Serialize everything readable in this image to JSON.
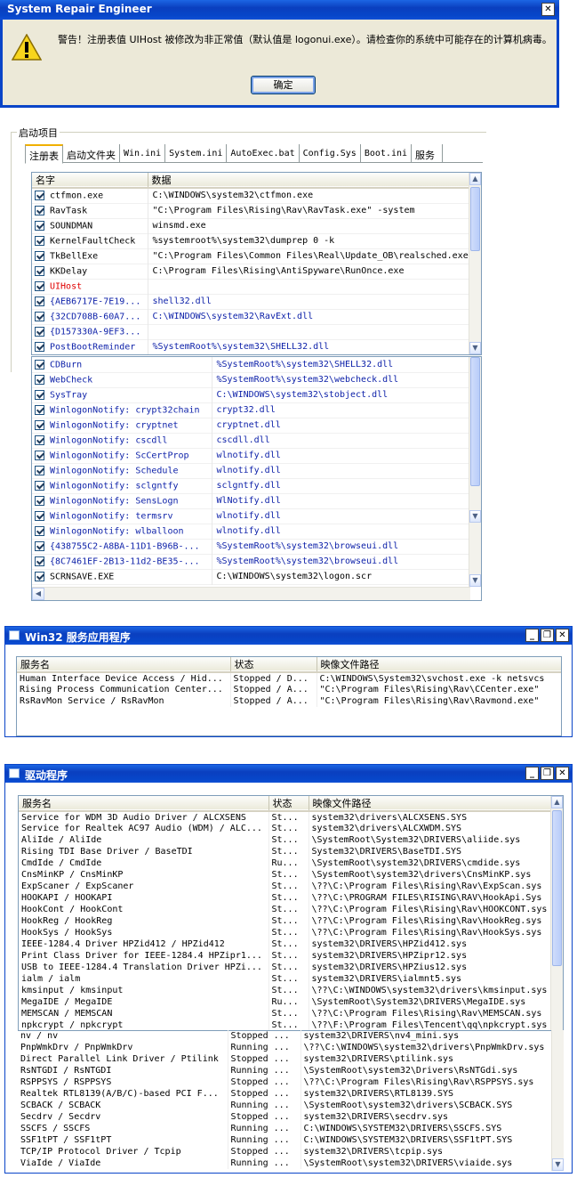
{
  "alert": {
    "title": "System Repair Engineer",
    "message": "警告！注册表值 UIHost 被修改为非正常值（默认值是 logonui.exe）。请检查你的系统中可能存在的计算机病毒。",
    "ok": "确定"
  },
  "startup": {
    "group_title": "启动项目",
    "tabs": [
      "注册表",
      "启动文件夹",
      "Win.ini",
      "System.ini",
      "AutoExec.bat",
      "Config.Sys",
      "Boot.ini",
      "服务"
    ],
    "columns": [
      "名字",
      "数据"
    ],
    "rows1": [
      {
        "name": "ctfmon.exe",
        "data": "C:\\WINDOWS\\system32\\ctfmon.exe",
        "color": "black"
      },
      {
        "name": "RavTask",
        "data": "\"C:\\Program Files\\Rising\\Rav\\RavTask.exe\" -system",
        "color": "black"
      },
      {
        "name": "SOUNDMAN",
        "data": "winsmd.exe",
        "color": "black"
      },
      {
        "name": "KernelFaultCheck",
        "data": "%systemroot%\\system32\\dumprep 0 -k",
        "color": "black"
      },
      {
        "name": "TkBellExe",
        "data": "\"C:\\Program Files\\Common Files\\Real\\Update_OB\\realsched.exe\"",
        "color": "black"
      },
      {
        "name": "KKDelay",
        "data": "C:\\Program Files\\Rising\\AntiSpyware\\RunOnce.exe",
        "color": "black"
      },
      {
        "name": "UIHost",
        "data": "",
        "color": "red"
      },
      {
        "name": "{AEB6717E-7E19...",
        "data": "shell32.dll",
        "color": "blue"
      },
      {
        "name": "{32CD708B-60A7...",
        "data": "C:\\WINDOWS\\system32\\RavExt.dll",
        "color": "blue"
      },
      {
        "name": "{D157330A-9EF3...",
        "data": "",
        "color": "blue"
      },
      {
        "name": "PostBootReminder",
        "data": "%SystemRoot%\\system32\\SHELL32.dll",
        "color": "blue"
      }
    ],
    "rows2": [
      {
        "name": "CDBurn",
        "data": "%SystemRoot%\\system32\\SHELL32.dll",
        "color": "blue"
      },
      {
        "name": "WebCheck",
        "data": "%SystemRoot%\\system32\\webcheck.dll",
        "color": "blue"
      },
      {
        "name": "SysTray",
        "data": "C:\\WINDOWS\\system32\\stobject.dll",
        "color": "blue"
      },
      {
        "name": "WinlogonNotify: crypt32chain",
        "data": "crypt32.dll",
        "color": "blue"
      },
      {
        "name": "WinlogonNotify: cryptnet",
        "data": "cryptnet.dll",
        "color": "blue"
      },
      {
        "name": "WinlogonNotify: cscdll",
        "data": "cscdll.dll",
        "color": "blue"
      },
      {
        "name": "WinlogonNotify: ScCertProp",
        "data": "wlnotify.dll",
        "color": "blue"
      },
      {
        "name": "WinlogonNotify: Schedule",
        "data": "wlnotify.dll",
        "color": "blue"
      },
      {
        "name": "WinlogonNotify: sclgntfy",
        "data": "sclgntfy.dll",
        "color": "blue"
      },
      {
        "name": "WinlogonNotify: SensLogn",
        "data": "WlNotify.dll",
        "color": "blue"
      },
      {
        "name": "WinlogonNotify: termsrv",
        "data": "wlnotify.dll",
        "color": "blue"
      },
      {
        "name": "WinlogonNotify: wlballoon",
        "data": "wlnotify.dll",
        "color": "blue"
      },
      {
        "name": "{438755C2-A8BA-11D1-B96B-...",
        "data": "%SystemRoot%\\system32\\browseui.dll",
        "color": "blue"
      },
      {
        "name": "{8C7461EF-2B13-11d2-BE35-...",
        "data": "%SystemRoot%\\system32\\browseui.dll",
        "color": "blue"
      },
      {
        "name": "SCRNSAVE.EXE",
        "data": "C:\\WINDOWS\\system32\\logon.scr",
        "color": "black"
      }
    ]
  },
  "services": {
    "title": "Win32 服务应用程序",
    "columns": [
      "服务名",
      "状态",
      "映像文件路径"
    ],
    "rows": [
      [
        "Human Interface Device Access / Hid...",
        "Stopped / D...",
        "C:\\WINDOWS\\System32\\svchost.exe -k netsvcs"
      ],
      [
        "Rising Process Communication Center...",
        "Stopped / A...",
        "\"C:\\Program Files\\Rising\\Rav\\CCenter.exe\""
      ],
      [
        "RsRavMon Service / RsRavMon",
        "Stopped / A...",
        "\"C:\\Program Files\\Rising\\Rav\\Ravmond.exe\""
      ]
    ]
  },
  "drivers": {
    "title": "驱动程序",
    "columns": [
      "服务名",
      "状态",
      "映像文件路径"
    ],
    "rows1": [
      [
        "Service for WDM 3D Audio Driver / ALCXSENS",
        "St...",
        "system32\\drivers\\ALCXSENS.SYS"
      ],
      [
        "Service for Realtek AC97 Audio (WDM) / ALC...",
        "St...",
        "system32\\drivers\\ALCXWDM.SYS"
      ],
      [
        "AliIde / AliIde",
        "St...",
        "\\SystemRoot\\System32\\DRIVERS\\aliide.sys"
      ],
      [
        "Rising TDI Base Driver / BaseTDI",
        "St...",
        "System32\\DRIVERS\\BaseTDI.SYS"
      ],
      [
        "CmdIde / CmdIde",
        "Ru...",
        "\\SystemRoot\\system32\\DRIVERS\\cmdide.sys"
      ],
      [
        "CnsMinKP / CnsMinKP",
        "St...",
        "\\SystemRoot\\system32\\drivers\\CnsMinKP.sys"
      ],
      [
        "ExpScaner / ExpScaner",
        "St...",
        "\\??\\C:\\Program Files\\Rising\\Rav\\ExpScan.sys"
      ],
      [
        "HOOKAPI / HOOKAPI",
        "St...",
        "\\??\\C:\\PROGRAM FILES\\RISING\\RAV\\HookApi.Sys"
      ],
      [
        "HookCont / HookCont",
        "St...",
        "\\??\\C:\\Program Files\\Rising\\Rav\\HOOKCONT.sys"
      ],
      [
        "HookReg / HookReg",
        "St...",
        "\\??\\C:\\Program Files\\Rising\\Rav\\HookReg.sys"
      ],
      [
        "HookSys / HookSys",
        "St...",
        "\\??\\C:\\Program Files\\Rising\\Rav\\HookSys.sys"
      ],
      [
        "IEEE-1284.4 Driver HPZid412 / HPZid412",
        "St...",
        "system32\\DRIVERS\\HPZid412.sys"
      ],
      [
        "Print Class Driver for IEEE-1284.4 HPZipr1...",
        "St...",
        "system32\\DRIVERS\\HPZipr12.sys"
      ],
      [
        "USB to IEEE-1284.4 Translation Driver HPZi...",
        "St...",
        "system32\\DRIVERS\\HPZius12.sys"
      ],
      [
        "ialm / ialm",
        "St...",
        "system32\\DRIVERS\\ialmnt5.sys"
      ],
      [
        "kmsinput / kmsinput",
        "St...",
        "\\??\\C:\\WINDOWS\\system32\\drivers\\kmsinput.sys"
      ],
      [
        "MegaIDE / MegaIDE",
        "Ru...",
        "\\SystemRoot\\System32\\DRIVERS\\MegaIDE.sys"
      ],
      [
        "MEMSCAN / MEMSCAN",
        "St...",
        "\\??\\C:\\Program Files\\Rising\\Rav\\MEMSCAN.sys"
      ],
      [
        "npkcrypt / npkcrypt",
        "St...",
        "\\??\\F:\\Program Files\\Tencent\\qq\\npkcrypt.sys"
      ]
    ],
    "rows2": [
      [
        "nv / nv",
        "Stopped ...",
        "system32\\DRIVERS\\nv4_mini.sys"
      ],
      [
        "PnpWmkDrv / PnpWmkDrv",
        "Running ...",
        "\\??\\C:\\WINDOWS\\system32\\drivers\\PnpWmkDrv.sys"
      ],
      [
        "Direct Parallel Link Driver / Ptilink",
        "Stopped ...",
        "system32\\DRIVERS\\ptilink.sys"
      ],
      [
        "RsNTGDI / RsNTGDI",
        "Running ...",
        "\\SystemRoot\\system32\\Drivers\\RsNTGdi.sys"
      ],
      [
        "RSPPSYS / RSPPSYS",
        "Stopped ...",
        "\\??\\C:\\Program Files\\Rising\\Rav\\RSPPSYS.sys"
      ],
      [
        "Realtek RTL8139(A/B/C)-based PCI F...",
        "Stopped ...",
        "system32\\DRIVERS\\RTL8139.SYS"
      ],
      [
        "SCBACK / SCBACK",
        "Running ...",
        "\\SystemRoot\\system32\\drivers\\SCBACK.SYS"
      ],
      [
        "Secdrv / Secdrv",
        "Stopped ...",
        "system32\\DRIVERS\\secdrv.sys"
      ],
      [
        "SSCFS / SSCFS",
        "Running ...",
        "C:\\WINDOWS\\SYSTEM32\\DRIVERS\\SSCFS.SYS"
      ],
      [
        "SSF1tPT / SSF1tPT",
        "Running ...",
        "C:\\WINDOWS\\SYSTEM32\\DRIVERS\\SSF1tPT.SYS"
      ],
      [
        "TCP/IP Protocol Driver / Tcpip",
        "Stopped ...",
        "system32\\DRIVERS\\tcpip.sys"
      ],
      [
        "ViaIde / ViaIde",
        "Running ...",
        "\\SystemRoot\\system32\\DRIVERS\\viaide.sys"
      ]
    ]
  }
}
